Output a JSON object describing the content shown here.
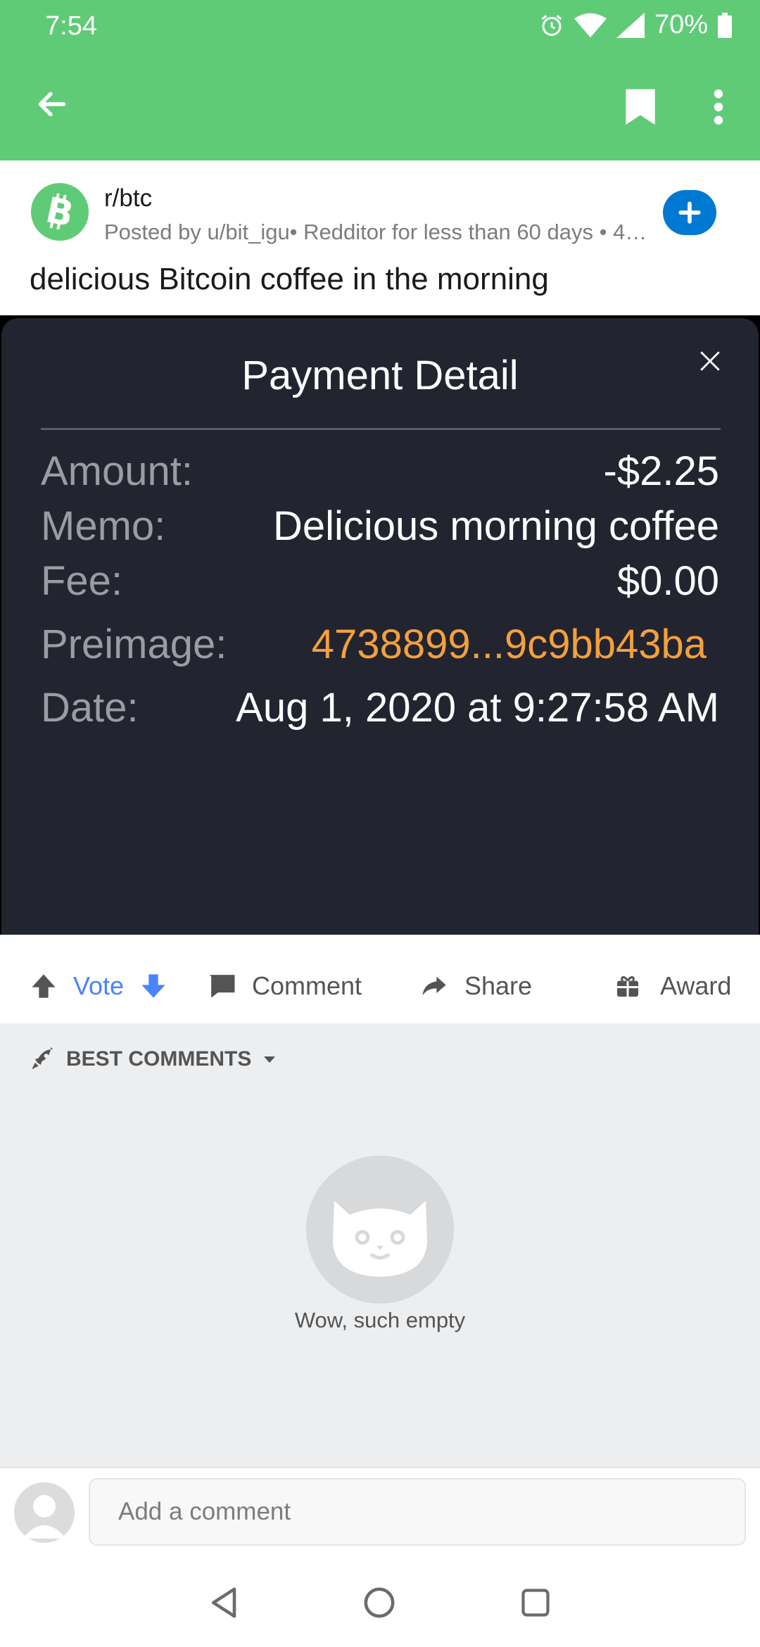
{
  "status_bar": {
    "time": "7:54",
    "battery": "70%"
  },
  "post": {
    "subreddit": "r/btc",
    "posted_by": "Posted by u/bit_igu• Redditor for less than 60 days • 4…",
    "title": "delicious Bitcoin coffee in the morning"
  },
  "payment": {
    "title": "Payment Detail",
    "rows": [
      {
        "label": "Amount:",
        "value": "-$2.25"
      },
      {
        "label": "Memo:",
        "value": "Delicious morning coffee"
      },
      {
        "label": "Fee:",
        "value": "$0.00"
      },
      {
        "label": "Preimage:",
        "value": "4738899...9c9bb43ba"
      },
      {
        "label": "Date:",
        "value": "Aug 1, 2020 at 9:27:58 AM"
      }
    ]
  },
  "actions": {
    "vote": "Vote",
    "comment": "Comment",
    "share": "Share",
    "award": "Award"
  },
  "comments": {
    "sort_label": "BEST COMMENTS",
    "empty_text": "Wow, such empty"
  },
  "comment_input": {
    "placeholder": "Add a comment"
  },
  "colors": {
    "accent": "#5fcb77",
    "vote": "#4a83ff",
    "preimage": "#f4a03c",
    "join": "#0079d3"
  },
  "icons": [
    "back-arrow-icon",
    "bookmark-icon",
    "more-vert-icon",
    "bitcoin-logo-icon",
    "plus-icon",
    "close-icon",
    "upvote-icon",
    "downvote-icon",
    "comment-icon",
    "share-icon",
    "award-icon",
    "rocket-icon",
    "dropdown-arrow-icon",
    "cat-face-icon",
    "user-icon",
    "nav-back-icon",
    "nav-home-icon",
    "nav-recents-icon"
  ]
}
